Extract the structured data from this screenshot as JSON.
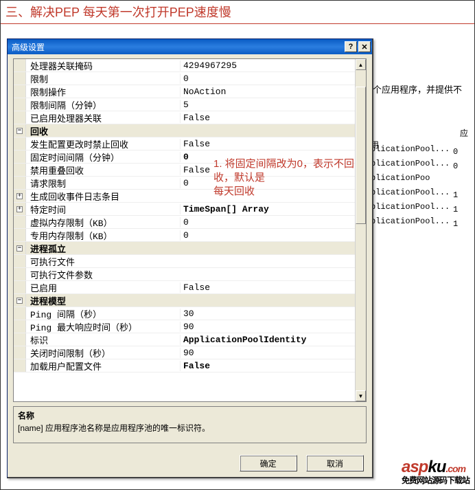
{
  "header": {
    "title": "三、解决PEP 每天第一次打开PEP速度慢"
  },
  "bg": {
    "hint": "多个应用程序，并提供不",
    "head_right": "应用",
    "rows": [
      {
        "name": "plicationPool...",
        "num": "0"
      },
      {
        "name": "plicationPool...",
        "num": "0"
      },
      {
        "name": "plicationPoo",
        "num": ""
      },
      {
        "name": "plicationPool...",
        "num": "1"
      },
      {
        "name": "plicationPool...",
        "num": "1"
      },
      {
        "name": "plicationPool...",
        "num": "1"
      }
    ]
  },
  "dialog": {
    "title": "高级设置",
    "ok": "确定",
    "cancel": "取消",
    "desc_name": "名称",
    "desc_text": "[name] 应用程序池名称是应用程序池的唯一标识符。",
    "rows": [
      {
        "type": "item",
        "label": "处理器关联掩码",
        "value": "4294967295"
      },
      {
        "type": "item",
        "label": "限制",
        "value": "0"
      },
      {
        "type": "item",
        "label": "限制操作",
        "value": "NoAction"
      },
      {
        "type": "item",
        "label": "限制间隔（分钟）",
        "value": "5"
      },
      {
        "type": "item",
        "label": "已启用处理器关联",
        "value": "False"
      },
      {
        "type": "cat",
        "sym": "-",
        "label": "回收",
        "value": ""
      },
      {
        "type": "item",
        "label": "发生配置更改时禁止回收",
        "value": "False"
      },
      {
        "type": "item",
        "label": "固定时间间隔（分钟）",
        "value": "0",
        "bold": true
      },
      {
        "type": "item",
        "label": "禁用重叠回收",
        "value": "False"
      },
      {
        "type": "item",
        "label": "请求限制",
        "value": "0"
      },
      {
        "type": "item",
        "sym": "+",
        "label": "生成回收事件日志条目",
        "value": ""
      },
      {
        "type": "item",
        "sym": "+",
        "label": "特定时间",
        "value": "TimeSpan[] Array",
        "bold": true
      },
      {
        "type": "item",
        "label": "虚拟内存限制（KB）",
        "value": "0"
      },
      {
        "type": "item",
        "label": "专用内存限制（KB）",
        "value": "0"
      },
      {
        "type": "cat",
        "sym": "-",
        "label": "进程孤立",
        "value": ""
      },
      {
        "type": "item",
        "label": "可执行文件",
        "value": ""
      },
      {
        "type": "item",
        "label": "可执行文件参数",
        "value": ""
      },
      {
        "type": "item",
        "label": "已启用",
        "value": "False"
      },
      {
        "type": "cat",
        "sym": "-",
        "label": "进程模型",
        "value": ""
      },
      {
        "type": "item",
        "label": "Ping 间隔（秒）",
        "value": "30"
      },
      {
        "type": "item",
        "label": "Ping 最大响应时间（秒）",
        "value": "90"
      },
      {
        "type": "item",
        "label": "标识",
        "value": "ApplicationPoolIdentity",
        "bold": true
      },
      {
        "type": "item",
        "label": "关闭时间限制（秒）",
        "value": "90"
      },
      {
        "type": "item",
        "label": "加载用户配置文件",
        "value": "False",
        "bold": true
      }
    ]
  },
  "annotations": {
    "a1_line1": "1. 将固定间隔改为0，表示不回收，默认是",
    "a1_line2": "每天回收"
  },
  "watermark": {
    "brand1": "asp",
    "brand2": "ku",
    "dot": ".com",
    "tag": "免费网站源码下载站"
  }
}
